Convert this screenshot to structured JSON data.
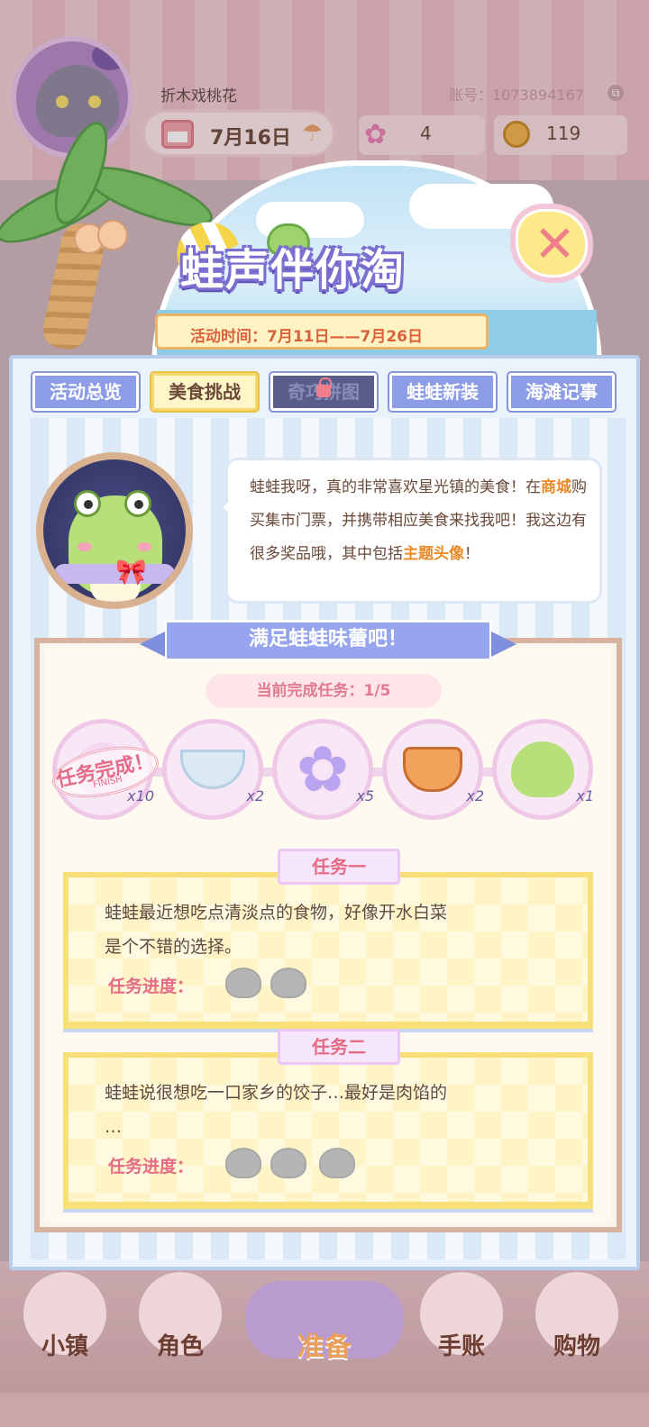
{
  "header": {
    "player_name": "折木戏桃花",
    "account_label": "账号：1073894167",
    "date": "7月16日",
    "flowers": "4",
    "coins": "119"
  },
  "banner": {
    "title": "蛙声伴你淘",
    "time_text": "活动时间：7月11日——7月26日"
  },
  "tabs": [
    {
      "label": "活动总览",
      "state": "normal"
    },
    {
      "label": "美食挑战",
      "state": "active"
    },
    {
      "label": "奇巧拼图",
      "state": "locked"
    },
    {
      "label": "蛙蛙新装",
      "state": "normal"
    },
    {
      "label": "海滩记事",
      "state": "normal"
    }
  ],
  "intro": {
    "text_1": "蛙蛙我呀，真的非常喜欢星光镇的美食！在",
    "highlight_1": "商城",
    "text_2": "购买集市门票，并携带相应美食来找我吧！我这边有很多奖品哦，其中包括",
    "highlight_2": "主题头像",
    "text_3": "！"
  },
  "section": {
    "title": "满足蛙蛙味蕾吧！",
    "progress": "当前完成任务：1/5"
  },
  "rewards": [
    {
      "name": "reward-1",
      "count": "x10",
      "stamp": "任务完成！",
      "stamp_sub": "FINISH"
    },
    {
      "name": "reward-2",
      "count": "x2"
    },
    {
      "name": "reward-3",
      "count": "x5"
    },
    {
      "name": "reward-4",
      "count": "x2"
    },
    {
      "name": "reward-5",
      "count": "x1"
    }
  ],
  "tasks": [
    {
      "tag": "任务一",
      "desc_1": "蛙蛙最近想吃点清淡点的食物，好像开水白菜",
      "desc_2": "是个不错的选择。",
      "progress_label": "任务进度：",
      "progress_total": 2
    },
    {
      "tag": "任务二",
      "desc_1": "蛙蛙说很想吃一口家乡的饺子…最好是肉馅的",
      "desc_2": "…",
      "progress_label": "任务进度：",
      "progress_total": 3
    }
  ],
  "nav": {
    "town": "小镇",
    "role": "角色",
    "prepare": "准备",
    "journal": "手账",
    "shop": "购物"
  },
  "colors": {
    "tab_normal": "#8c9ce6",
    "tab_active": "#fff6c8",
    "highlight": "#e88a2a",
    "task_accent": "#e46c86"
  }
}
